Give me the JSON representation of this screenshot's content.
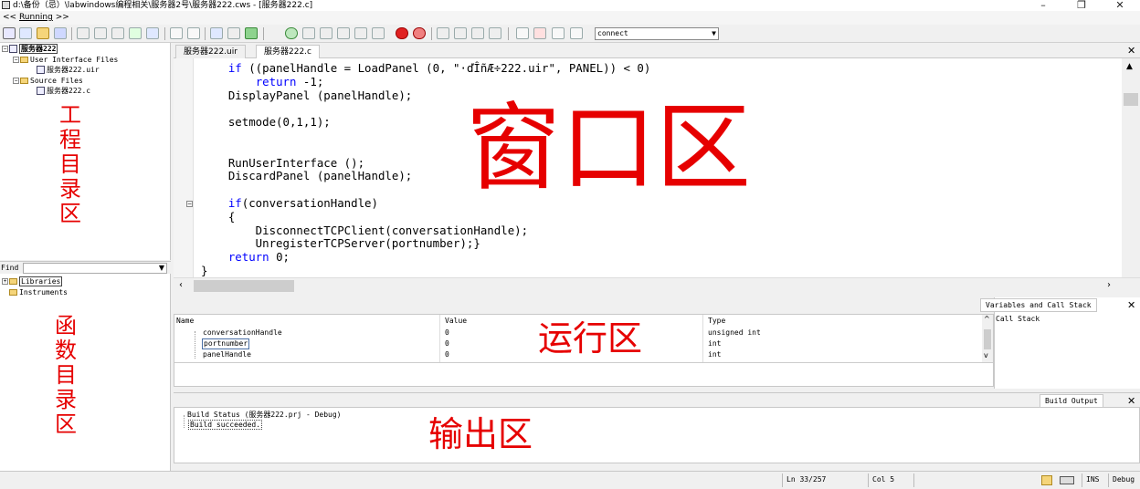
{
  "window": {
    "title": "d:\\备份（忌）\\labwindows编程相关\\服务器2号\\服务器222.cws - [服务器222.c]",
    "minimize": "–",
    "restore": "❐",
    "close": "✕"
  },
  "menubar": {
    "prefix": "<< ",
    "running": "Running",
    "suffix": " >>"
  },
  "toolbar": {
    "combo_value": "connect",
    "combo_arrow": "▼"
  },
  "project_tree": {
    "root": "服务器222",
    "uif_folder": "User Interface Files",
    "uir_file": "服务器222.uir",
    "src_folder": "Source Files",
    "c_file": "服务器222.c"
  },
  "annotations": {
    "project_dir": [
      "工",
      "程",
      "目",
      "录",
      "区"
    ],
    "function_dir": [
      "函",
      "数",
      "目",
      "录",
      "区"
    ],
    "window_area": "窗口区",
    "run_area": "运行区",
    "output_area": "输出区"
  },
  "find": {
    "label": "Find",
    "value": "",
    "arrow": "▼"
  },
  "library_tree": {
    "libraries": "Libraries",
    "instruments": "Instruments"
  },
  "tabs": [
    {
      "label": "服务器222.uir"
    },
    {
      "label": "服务器222.c"
    }
  ],
  "code_lines": [
    {
      "pre": "    ",
      "kw": "if",
      "post": " ((panelHandle = LoadPanel (0, \"·ďÎñÆ÷222.uir\", PANEL)) < 0)"
    },
    {
      "pre": "        ",
      "kw": "return",
      "post": " -1;"
    },
    {
      "pre": "    DisplayPanel (panelHandle);",
      "kw": "",
      "post": ""
    },
    {
      "pre": "",
      "kw": "",
      "post": ""
    },
    {
      "pre": "    setmode(0,1,1);",
      "kw": "",
      "post": ""
    },
    {
      "pre": "",
      "kw": "",
      "post": ""
    },
    {
      "pre": "",
      "kw": "",
      "post": ""
    },
    {
      "pre": "    RunUserInterface ();",
      "kw": "",
      "post": ""
    },
    {
      "pre": "    DiscardPanel (panelHandle);",
      "kw": "",
      "post": ""
    },
    {
      "pre": "",
      "kw": "",
      "post": ""
    },
    {
      "pre": "    ",
      "kw": "if",
      "post": "(conversationHandle)"
    },
    {
      "pre": "    {",
      "kw": "",
      "post": ""
    },
    {
      "pre": "        DisconnectTCPClient(conversationHandle);",
      "kw": "",
      "post": ""
    },
    {
      "pre": "        UnregisterTCPServer(portnumber);}",
      "kw": "",
      "post": ""
    },
    {
      "pre": "    ",
      "kw": "return",
      "post": " 0;"
    },
    {
      "pre": "}",
      "kw": "",
      "post": ""
    }
  ],
  "variables": {
    "headers": {
      "name": "Name",
      "value": "Value",
      "type": "Type"
    },
    "rows": [
      {
        "name": "conversationHandle",
        "value": "0",
        "type": "unsigned int"
      },
      {
        "name": "portnumber",
        "value": "0",
        "type": "int"
      },
      {
        "name": "panelHandle",
        "value": "0",
        "type": "int"
      }
    ]
  },
  "variables_panel": {
    "tab": "Variables and Call Stack",
    "call_stack": "Call Stack"
  },
  "build_output": {
    "tab": "Build Output",
    "status": "Build Status (服务器222.prj - Debug)",
    "result": "Build succeeded."
  },
  "statusbar": {
    "line": "Ln 33/257",
    "col": "Col 5",
    "ins": "INS",
    "mode": "Debug"
  }
}
